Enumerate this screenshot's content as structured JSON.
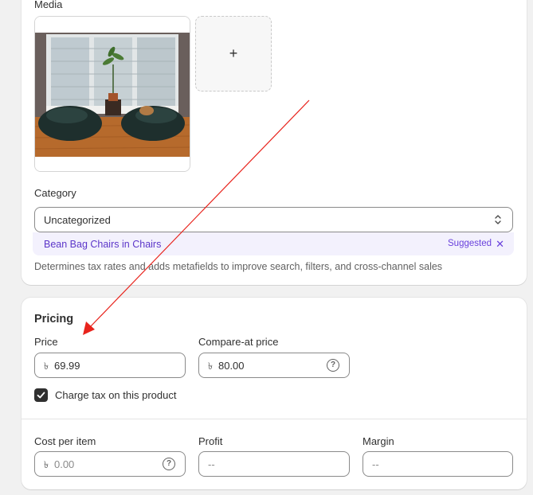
{
  "media": {
    "label": "Media",
    "add_button": "+"
  },
  "category": {
    "label": "Category",
    "value": "Uncategorized",
    "suggestion": {
      "name": "Bean Bag Chairs",
      "connector": "in",
      "parent": "Chairs",
      "tag": "Suggested",
      "dismiss": "✕"
    },
    "help": "Determines tax rates and adds metafields to improve search, filters, and cross-channel sales"
  },
  "pricing": {
    "title": "Pricing",
    "currency_symbol": "৳",
    "price": {
      "label": "Price",
      "value": "69.99"
    },
    "compare_at": {
      "label": "Compare-at price",
      "value": "80.00"
    },
    "charge_tax": {
      "label": "Charge tax on this product",
      "checked": true
    },
    "cost": {
      "label": "Cost per item",
      "placeholder": "0.00"
    },
    "profit": {
      "label": "Profit",
      "value": "--"
    },
    "margin": {
      "label": "Margin",
      "value": "--"
    }
  },
  "colors": {
    "accent_purple": "#5c36c9",
    "annotation_arrow": "#e8231c",
    "checkbox": "#303030"
  },
  "icons": {
    "select": "chevron-up-down-icon",
    "help": "question-circle-icon",
    "check": "checkmark-icon",
    "close": "close-icon"
  }
}
